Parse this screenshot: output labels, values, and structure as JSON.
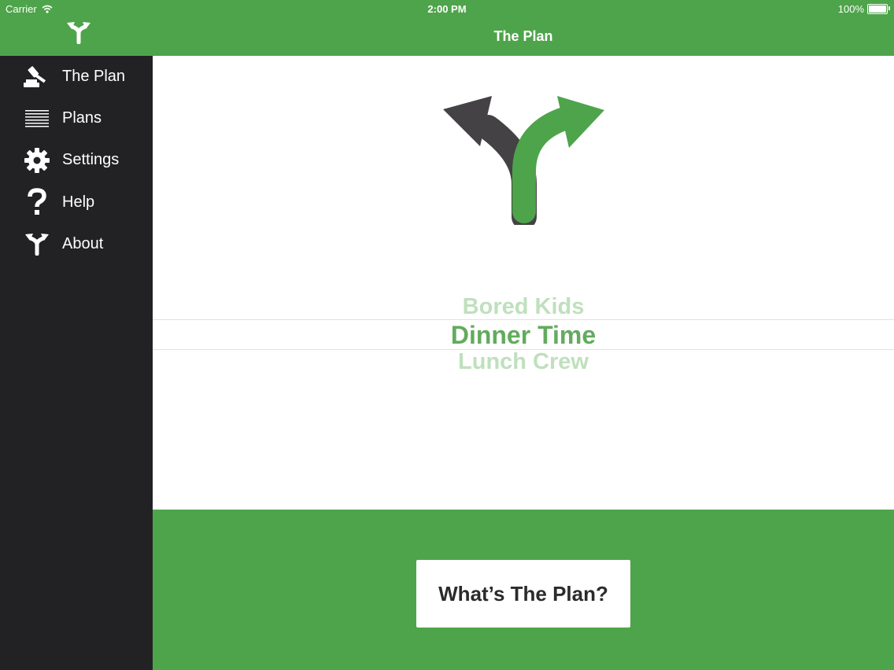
{
  "status_bar": {
    "carrier": "Carrier",
    "time": "2:00 PM",
    "battery": "100%"
  },
  "colors": {
    "brand_green": "#4ea44a",
    "sidebar_dark": "#222225",
    "picker_selected": "#62ab5e",
    "picker_faded": "#bfe0bd",
    "fork_dark": "#444245"
  },
  "sidebar": {
    "logo_icon": "fork-arrow-icon",
    "items": [
      {
        "label": "The Plan",
        "icon": "gavel-icon"
      },
      {
        "label": "Plans",
        "icon": "list-lines-icon"
      },
      {
        "label": "Settings",
        "icon": "gear-icon"
      },
      {
        "label": "Help",
        "icon": "question-mark-icon"
      },
      {
        "label": "About",
        "icon": "fork-arrow-icon"
      }
    ]
  },
  "nav": {
    "title": "The Plan"
  },
  "picker": {
    "options": [
      "Bored Kids",
      "Dinner Time",
      "Lunch Crew"
    ],
    "selected": "Dinner Time"
  },
  "footer": {
    "button_label": "What’s The Plan?"
  }
}
